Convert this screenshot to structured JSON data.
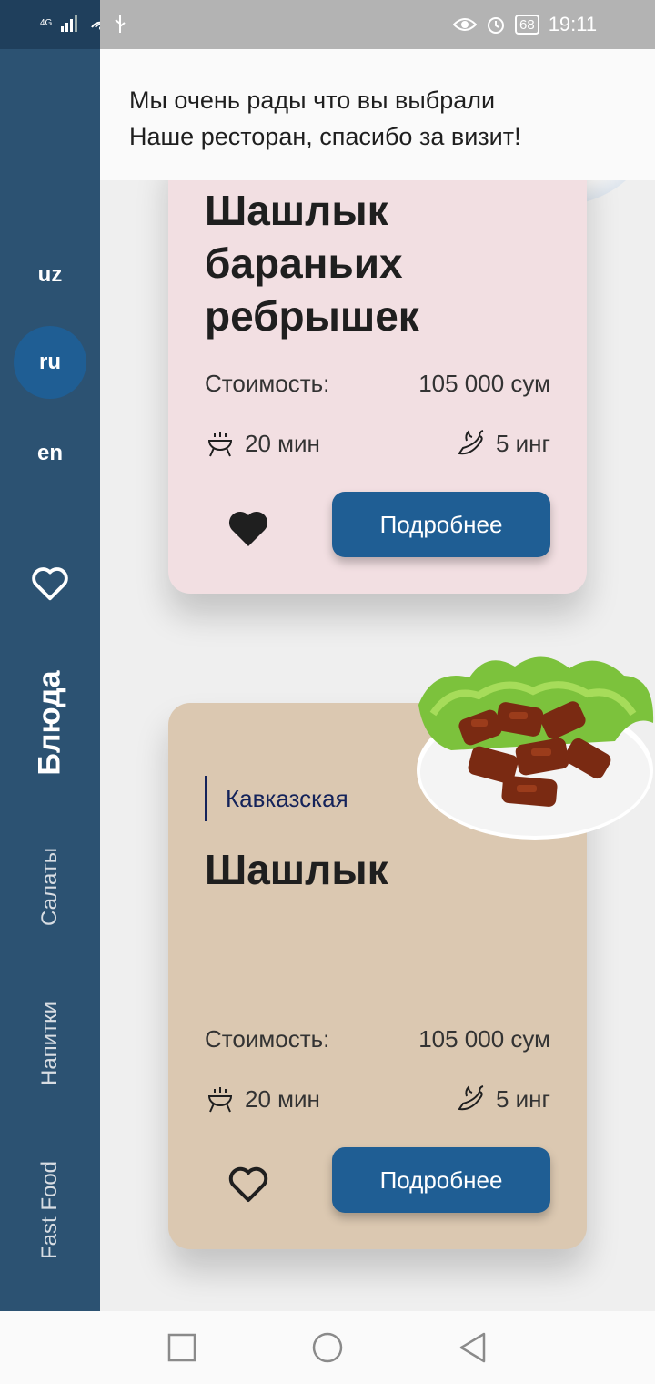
{
  "status_bar": {
    "signal": "4G",
    "time": "19:11",
    "battery": "68",
    "icons": [
      "signal-icon",
      "wifi-icon",
      "usb-icon",
      "eye-icon",
      "alarm-icon",
      "battery-icon"
    ]
  },
  "header": {
    "message": "Мы очень рады что  вы выбрали\nНаше ресторан, спасибо за визит!"
  },
  "sidebar": {
    "languages": [
      {
        "code": "uz",
        "active": false
      },
      {
        "code": "ru",
        "active": true
      },
      {
        "code": "en",
        "active": false
      }
    ],
    "favorites_icon": "heart-outline-icon",
    "categories": [
      {
        "label": "Блюда",
        "active": true
      },
      {
        "label": "Салаты",
        "active": false
      },
      {
        "label": "Напитки",
        "active": false
      },
      {
        "label": "Fast Food",
        "active": false
      }
    ]
  },
  "cards": [
    {
      "category": "",
      "title_lines": [
        "Шашлык",
        "бараньих",
        "ребрышек"
      ],
      "price_label": "Стоимость:",
      "price": "105 000 сум",
      "time": "20 мин",
      "ingredients": "5 инг",
      "favorited": true,
      "button": "Подробнее",
      "bg_color": "#f2dfe2"
    },
    {
      "category": "Кавказская",
      "title_lines": [
        "Шашлык"
      ],
      "price_label": "Стоимость:",
      "price": "105 000 сум",
      "time": "20 мин",
      "ingredients": "5 инг",
      "favorited": false,
      "button": "Подробнее",
      "bg_color": "#dbc8b1"
    }
  ],
  "colors": {
    "sidebar": "#2c5272",
    "accent": "#1f5e94",
    "status_left": "#1f3f5c",
    "status_right": "#b3b3b3"
  }
}
